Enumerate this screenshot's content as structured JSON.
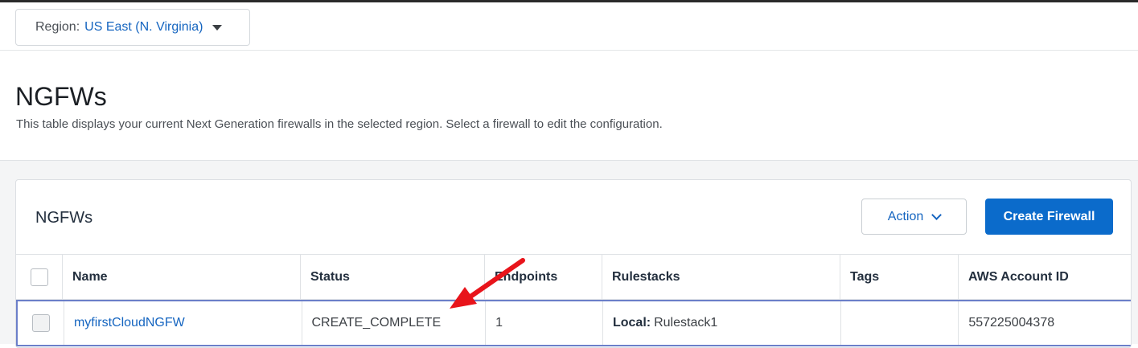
{
  "region": {
    "label": "Region:",
    "value": "US East (N. Virginia)"
  },
  "header": {
    "title": "NGFWs",
    "description": "This table displays your current Next Generation firewalls in the selected region. Select a firewall to edit the configuration."
  },
  "card": {
    "title": "NGFWs",
    "action_label": "Action",
    "create_label": "Create Firewall"
  },
  "table": {
    "columns": [
      "Name",
      "Status",
      "Endpoints",
      "Rulestacks",
      "Tags",
      "AWS Account ID"
    ],
    "rows": [
      {
        "name": "myfirstCloudNGFW",
        "status": "CREATE_COMPLETE",
        "endpoints": "1",
        "rulestack_prefix": "Local:",
        "rulestack_value": "Rulestack1",
        "tags": "",
        "account_id": "557225004378"
      }
    ]
  },
  "colors": {
    "accent": "#0b6bcb",
    "link": "#1565c0",
    "annotation_arrow": "#e8141b",
    "selected_row_border": "#6b7fc9"
  },
  "icons": [
    "caret-down-icon",
    "chevron-down-icon",
    "checkbox-icon",
    "red-arrow-annotation"
  ]
}
